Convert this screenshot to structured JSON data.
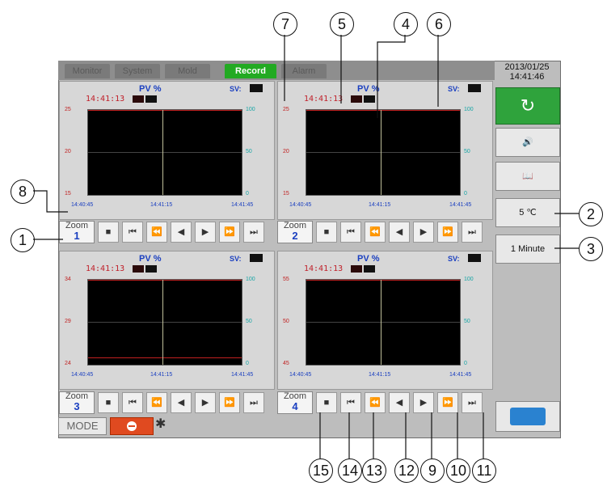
{
  "tabs": [
    {
      "label": "Monitor"
    },
    {
      "label": "System"
    },
    {
      "label": "Mold"
    },
    {
      "label": "Record"
    },
    {
      "label": "Alarm"
    }
  ],
  "datetime": {
    "date": "2013/01/25",
    "time": "14:41:46"
  },
  "panels": [
    {
      "pv": "PV",
      "pct": "%",
      "sv_label": "SV:",
      "time": "14:41:13",
      "y_left": [
        "25",
        "20",
        "15"
      ],
      "y_right": [
        "100",
        "50",
        "0"
      ],
      "x": [
        "14:40:45",
        "14:41:15",
        "14:41:45"
      ],
      "zoom_label": "Zoom",
      "zoom_number": "1"
    },
    {
      "pv": "PV",
      "pct": "%",
      "sv_label": "SV:",
      "time": "14:41:13",
      "y_left": [
        "25",
        "20",
        "15"
      ],
      "y_right": [
        "100",
        "50",
        "0"
      ],
      "x": [
        "14:40:45",
        "14:41:15",
        "14:41:45"
      ],
      "zoom_label": "Zoom",
      "zoom_number": "2"
    },
    {
      "pv": "PV",
      "pct": "%",
      "sv_label": "SV:",
      "time": "14:41:13",
      "y_left": [
        "34",
        "29",
        "24"
      ],
      "y_right": [
        "100",
        "50",
        "0"
      ],
      "x": [
        "14:40:45",
        "14:41:15",
        "14:41:45"
      ],
      "zoom_label": "Zoom",
      "zoom_number": "3"
    },
    {
      "pv": "PV",
      "pct": "%",
      "sv_label": "SV:",
      "time": "14:41:13",
      "y_left": [
        "55",
        "50",
        "45"
      ],
      "y_right": [
        "100",
        "50",
        "0"
      ],
      "x": [
        "14:40:45",
        "14:41:15",
        "14:41:45"
      ],
      "zoom_label": "Zoom",
      "zoom_number": "4"
    }
  ],
  "controls": [
    "■",
    "⏮",
    "⏪",
    "◀",
    "▶",
    "⏩",
    "⏭"
  ],
  "sidebar": {
    "refresh_icon": "refresh-icon",
    "speaker_icon": "speaker-icon",
    "book_icon": "book-icon",
    "temp_label": "5 ℃",
    "interval_label": "1 Minute",
    "usb_icon": "usb-icon"
  },
  "footer": {
    "mode_label": "MODE"
  },
  "callouts": [
    "1",
    "2",
    "3",
    "4",
    "5",
    "6",
    "7",
    "8",
    "9",
    "10",
    "11",
    "12",
    "13",
    "14",
    "15"
  ],
  "colors": {
    "accent": "#22aa22",
    "pv_red": "#c02020",
    "cyan": "#18a6a6",
    "blue": "#1a3fc0",
    "stop": "#e04a20"
  }
}
